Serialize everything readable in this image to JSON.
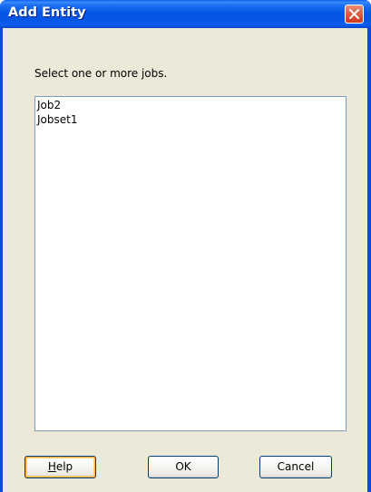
{
  "window": {
    "title": "Add Entity"
  },
  "dialog": {
    "prompt": "Select one or more jobs.",
    "jobs": [
      "Job2",
      "Jobset1"
    ]
  },
  "buttons": {
    "help_label_mnemonic": "H",
    "help_label_rest": "elp",
    "ok_label": "OK",
    "cancel_label": "Cancel"
  },
  "icons": {
    "close": "close-icon"
  },
  "colors": {
    "titlebar": "#0555e4",
    "close_button": "#d4482a",
    "dialog_background": "#ece9d8",
    "list_border": "#7f9db9",
    "default_button_highlight": "#f8b33f"
  }
}
